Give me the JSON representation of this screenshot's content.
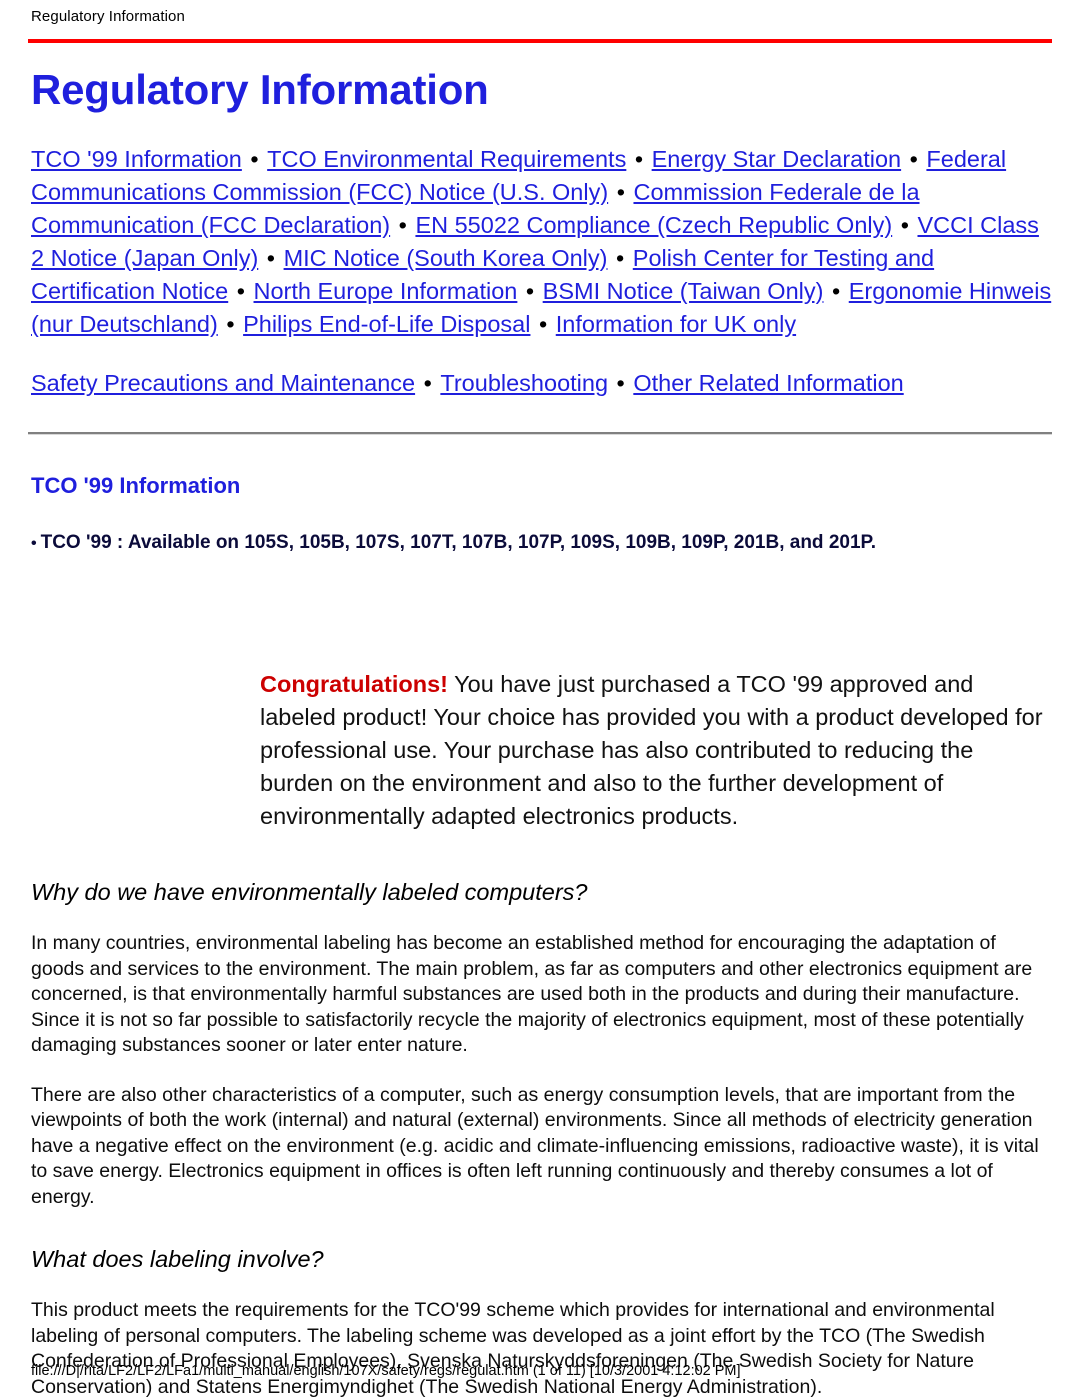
{
  "header": {
    "breadcrumb_label": "Regulatory Information",
    "title": "Regulatory Information",
    "rule_color": "#ff0000"
  },
  "colors": {
    "link": "#1f1fdd",
    "heading": "#1f1fdd",
    "accent_red": "#cc0000",
    "rule_red": "#ff0000",
    "rule_gray": "#808080",
    "body_text": "#000000"
  },
  "nav": {
    "separator": "•",
    "group_one": [
      "TCO '99 Information",
      "TCO Environmental Requirements",
      "Energy Star Declaration",
      "Federal Communications Commission (FCC) Notice (U.S. Only)",
      "Commission Federale de la Communication (FCC Declaration)",
      "EN 55022 Compliance (Czech Republic Only)",
      "VCCI Class 2 Notice (Japan Only)",
      "MIC Notice (South Korea Only)",
      "Polish Center for Testing and Certification Notice",
      "North Europe Information",
      "BSMI Notice (Taiwan Only)",
      "Ergonomie Hinweis (nur Deutschland)",
      "Philips End-of-Life Disposal",
      "Information for UK only"
    ],
    "group_two": [
      "Safety Precautions and Maintenance",
      "Troubleshooting",
      "Other Related Information"
    ]
  },
  "sections": {
    "tco99": {
      "heading": "TCO '99 Information",
      "bullet_marker": "•",
      "bullet_text": "TCO '99 : Available on 105S, 105B, 107S, 107T, 107B, 107P, 109S, 109B, 109P, 201B, and 201P.",
      "congratulations_lead": "Congratulations!",
      "congratulations_body": " You have just purchased a TCO '99 approved and labeled product! Your choice has provided you with a product developed for professional use. Your purchase has also contributed to reducing the burden on the environment and also to the further development of environmentally adapted electronics products."
    },
    "why_labeled": {
      "heading": "Why do we have environmentally labeled computers?",
      "paragraph_1": "In many countries, environmental labeling has become an established method for encouraging the adaptation of goods and services to the environment. The main problem, as far as computers and other electronics equipment are concerned, is that environmentally harmful substances are used both in the products and during their manufacture. Since it is not so far possible to satisfactorily recycle the majority of electronics equipment, most of these potentially damaging substances sooner or later enter nature.",
      "paragraph_2": "There are also other characteristics of a computer, such as energy consumption levels, that are important from the viewpoints of both the work (internal) and natural (external) environments. Since all methods of electricity generation have a negative effect on the environment (e.g. acidic and climate-influencing emissions, radioactive waste), it is vital to save energy. Electronics equipment in offices is often left running continuously and thereby consumes a lot of energy."
    },
    "labeling_involve": {
      "heading": "What does labeling involve?",
      "paragraph_1": "This product meets the requirements for the TCO'99 scheme which provides for international and environmental labeling of personal computers. The labeling scheme was developed as a joint effort by the TCO (The Swedish Confederation of Professional Employees), Svenska Naturskyddsforeningen (The Swedish Society for Nature Conservation) and Statens Energimyndighet (The Swedish National Energy Administration)."
    }
  },
  "footer": {
    "status_text": "file:///D|/rita/LF2/LF2/LFa1/multi_manual/english/107X/safety/regs/regulat.htm (1 of 11) [10/3/2001 4:12:02 PM]"
  }
}
